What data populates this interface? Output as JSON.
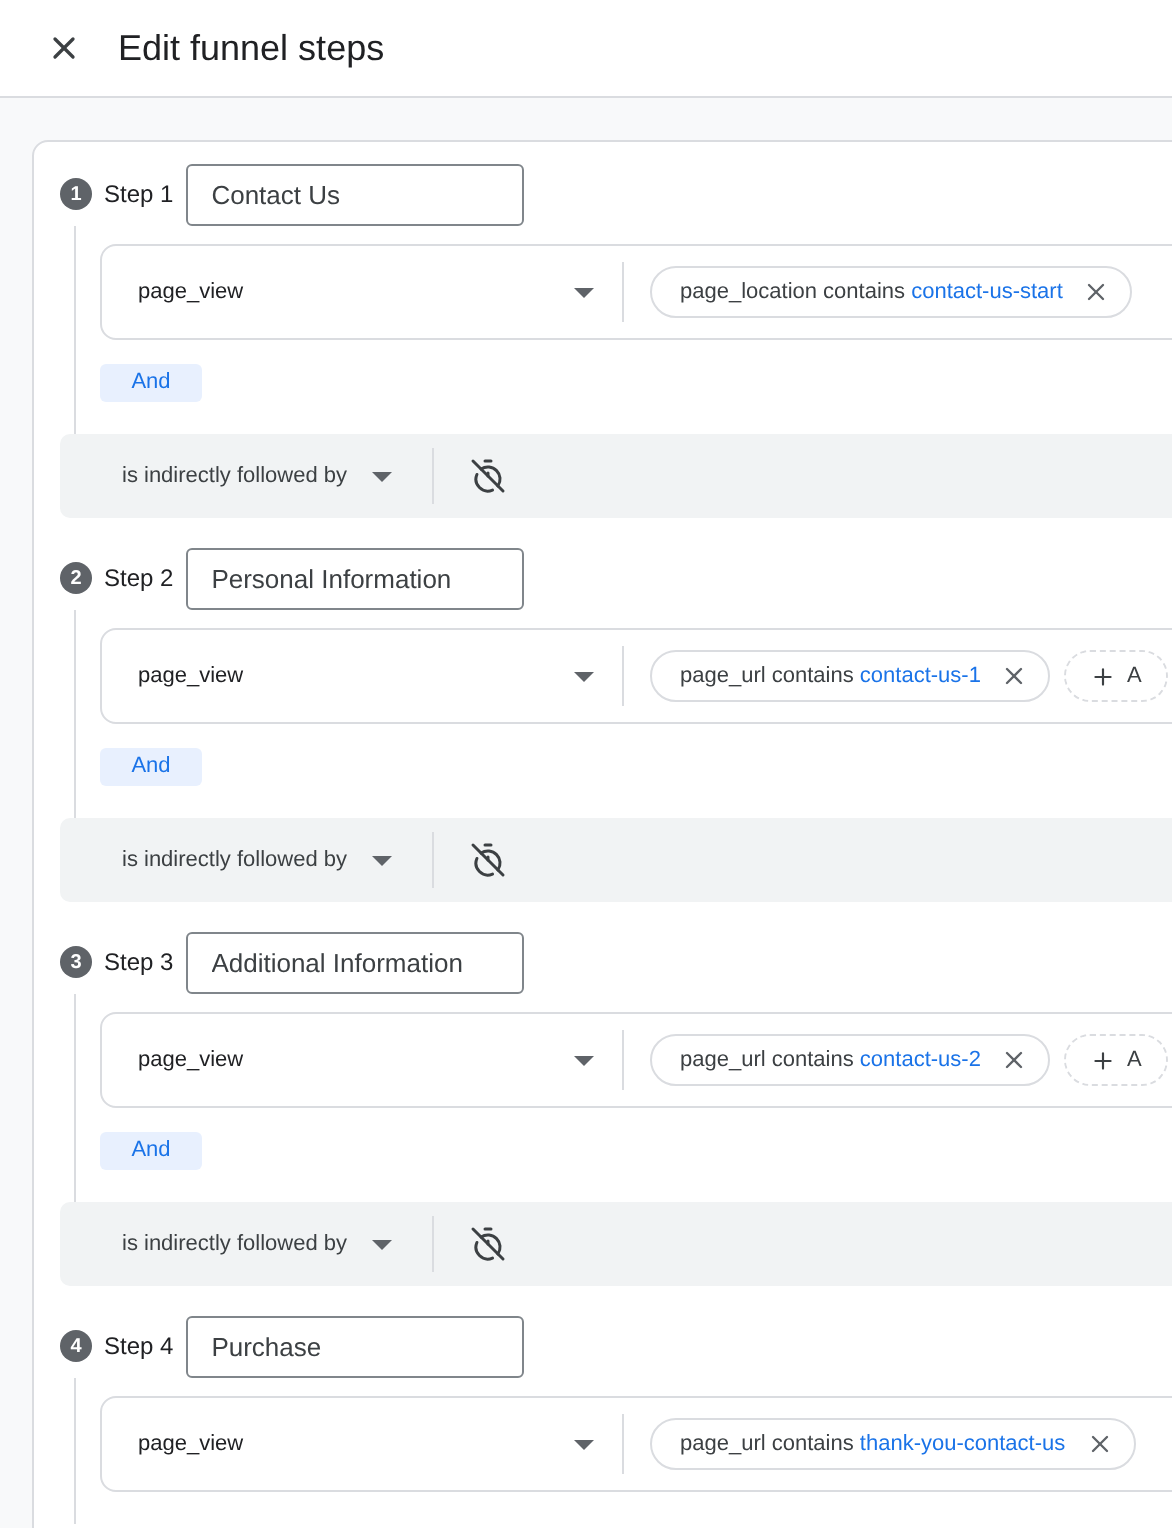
{
  "header": {
    "title": "Edit funnel steps"
  },
  "steps": [
    {
      "number": "1",
      "label": "Step 1",
      "name": "Contact Us",
      "event": "page_view",
      "condition": {
        "param": "page_location contains",
        "value": "contact-us-start"
      },
      "and_label": "And",
      "followed_by": "is indirectly followed by"
    },
    {
      "number": "2",
      "label": "Step 2",
      "name": "Personal Information",
      "event": "page_view",
      "condition": {
        "param": "page_url contains",
        "value": "contact-us-1"
      },
      "add_label": "A",
      "and_label": "And",
      "followed_by": "is indirectly followed by"
    },
    {
      "number": "3",
      "label": "Step 3",
      "name": "Additional Information",
      "event": "page_view",
      "condition": {
        "param": "page_url contains",
        "value": "contact-us-2"
      },
      "add_label": "A",
      "and_label": "And",
      "followed_by": "is indirectly followed by"
    },
    {
      "number": "4",
      "label": "Step 4",
      "name": "Purchase",
      "event": "page_view",
      "condition": {
        "param": "page_url contains",
        "value": "thank-you-contact-us"
      }
    }
  ]
}
